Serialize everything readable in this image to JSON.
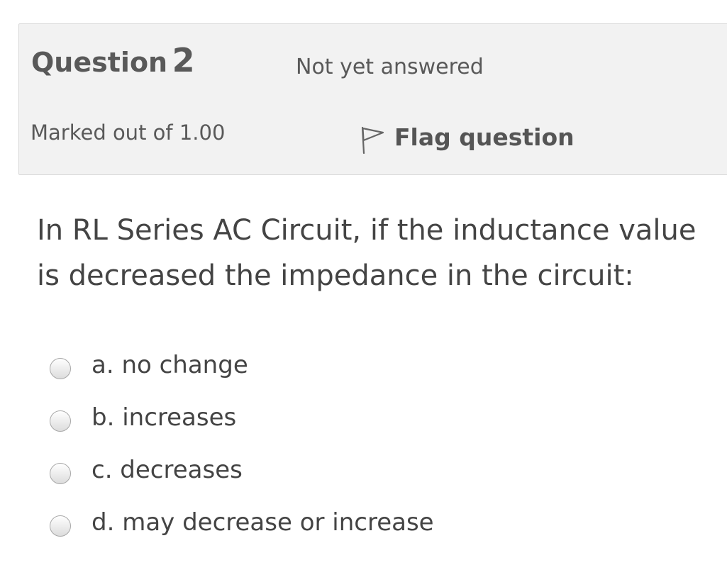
{
  "question": {
    "word": "Question",
    "number": "2",
    "state": "Not yet answered",
    "grade": "Marked out of 1.00",
    "flag_label": "Flag question",
    "flag_icon": "flag-outline-icon",
    "text": "In RL Series AC Circuit, if the inductance value is decreased the impedance in the circuit:"
  },
  "answers": [
    {
      "label": "a. no change",
      "selected": false
    },
    {
      "label": "b. increases",
      "selected": false
    },
    {
      "label": "c. decreases",
      "selected": false
    },
    {
      "label": "d. may decrease or increase",
      "selected": false
    }
  ],
  "colors": {
    "info_background": "#f2f2f2",
    "info_border": "#d9d9d9",
    "text": "#444444",
    "muted_text": "#595959"
  }
}
